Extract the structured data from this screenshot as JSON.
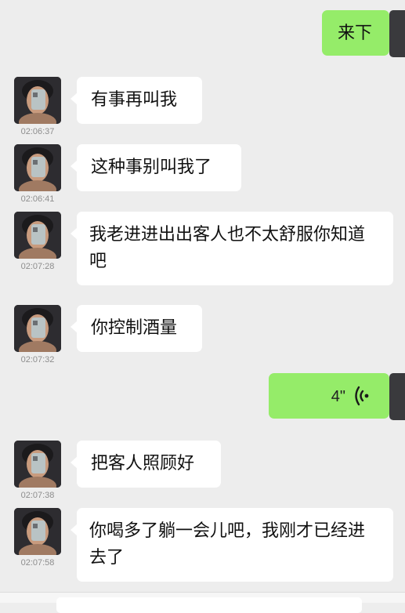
{
  "conversation": {
    "messages": [
      {
        "side": "out",
        "type": "text",
        "text": "来下"
      },
      {
        "side": "in",
        "type": "text",
        "text": "有事再叫我",
        "time": "02:06:37"
      },
      {
        "side": "in",
        "type": "text",
        "text": "这种事别叫我了",
        "time": "02:06:41"
      },
      {
        "side": "in",
        "type": "text",
        "text": "我老进进出出客人也不太舒服你知道吧",
        "time": "02:07:28"
      },
      {
        "side": "in",
        "type": "text",
        "text": "你控制酒量",
        "time": "02:07:32"
      },
      {
        "side": "out",
        "type": "voice",
        "duration": "4\""
      },
      {
        "side": "in",
        "type": "text",
        "text": "把客人照顾好",
        "time": "02:07:38"
      },
      {
        "side": "in",
        "type": "text",
        "text": "你喝多了躺一会儿吧，我刚才已经进去了",
        "time": "02:07:58"
      }
    ]
  },
  "colors": {
    "background": "#ededed",
    "incoming_bubble": "#ffffff",
    "outgoing_bubble": "#95ec69",
    "timestamp": "#8e8e8e"
  },
  "icons": {
    "voice": "voice-wave-icon",
    "avatar": "contact-avatar-icon"
  }
}
